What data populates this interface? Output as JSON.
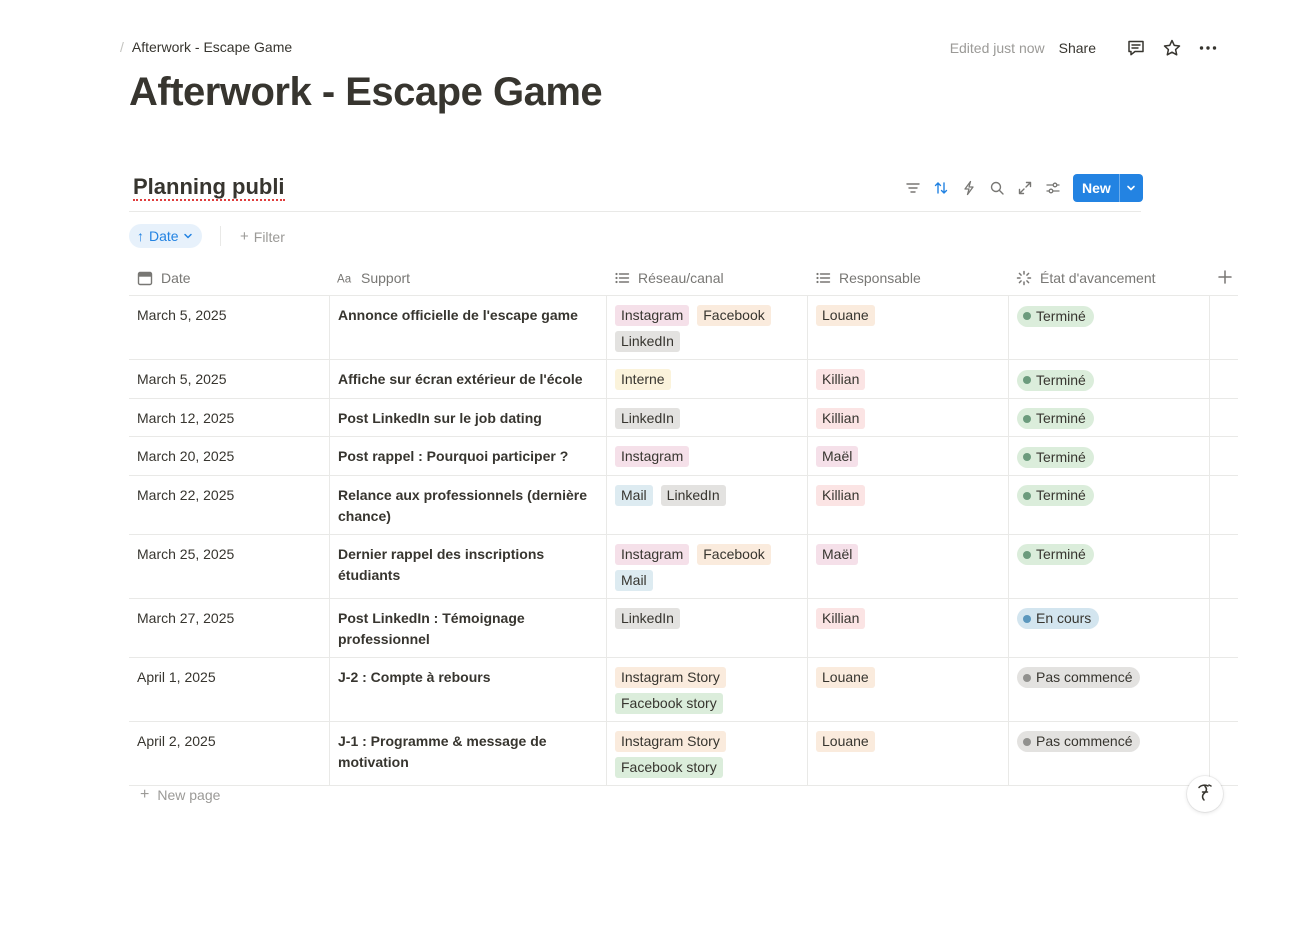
{
  "topbar": {
    "breadcrumb": "Afterwork - Escape Game",
    "edited": "Edited just now",
    "share_label": "Share"
  },
  "page": {
    "title": "Afterwork - Escape Game"
  },
  "database": {
    "title": "Planning publi",
    "new_label": "New",
    "sort_label": "Date",
    "filter_label": "Filter",
    "new_page_label": "New page",
    "columns": [
      "Date",
      "Support",
      "Réseau/canal",
      "Responsable",
      "État d'avancement"
    ],
    "rows": [
      {
        "date": "March 5, 2025",
        "support": "Annonce officielle de l'escape game",
        "channels": [
          "Instagram",
          "Facebook",
          "LinkedIn"
        ],
        "owner": "Louane",
        "status": "Terminé"
      },
      {
        "date": "March 5, 2025",
        "support": "Affiche sur écran extérieur de l'école",
        "channels": [
          "Interne"
        ],
        "owner": "Killian",
        "status": "Terminé"
      },
      {
        "date": "March 12, 2025",
        "support": "Post LinkedIn sur le job dating",
        "channels": [
          "LinkedIn"
        ],
        "owner": "Killian",
        "status": "Terminé"
      },
      {
        "date": "March 20, 2025",
        "support": "Post rappel : Pourquoi participer ?",
        "channels": [
          "Instagram"
        ],
        "owner": "Maël",
        "status": "Terminé"
      },
      {
        "date": "March 22, 2025",
        "support": "Relance aux professionnels (dernière chance)",
        "channels": [
          "Mail",
          "LinkedIn"
        ],
        "owner": "Killian",
        "status": "Terminé"
      },
      {
        "date": "March 25, 2025",
        "support": "Dernier rappel des inscriptions étudiants",
        "channels": [
          "Instagram",
          "Facebook",
          "Mail"
        ],
        "owner": "Maël",
        "status": "Terminé"
      },
      {
        "date": "March 27, 2025",
        "support": "Post LinkedIn : Témoignage professionnel",
        "channels": [
          "LinkedIn"
        ],
        "owner": "Killian",
        "status": "En cours"
      },
      {
        "date": "April 1, 2025",
        "support": "J-2 : Compte à rebours",
        "channels": [
          "Instagram Story",
          "Facebook story"
        ],
        "owner": "Louane",
        "status": "Pas commencé"
      },
      {
        "date": "April 2, 2025",
        "support": "J-1 : Programme & message de motivation",
        "channels": [
          "Instagram Story",
          "Facebook story"
        ],
        "owner": "Louane",
        "status": "Pas commencé"
      }
    ]
  },
  "colors": {
    "accent": "#2383e2",
    "status_done": "#dbeddb",
    "status_in_progress": "#d3e5ef",
    "status_not_started": "#e3e2e0"
  },
  "icons": {
    "topbar": [
      "comment-icon",
      "star-icon",
      "more-icon"
    ],
    "tools": [
      "filter-icon",
      "sort-icon",
      "automation-icon",
      "search-icon",
      "expand-icon",
      "settings-icon"
    ],
    "columns": [
      "calendar-icon",
      "text-icon",
      "multi-select-icon",
      "multi-select-icon",
      "status-icon"
    ]
  }
}
